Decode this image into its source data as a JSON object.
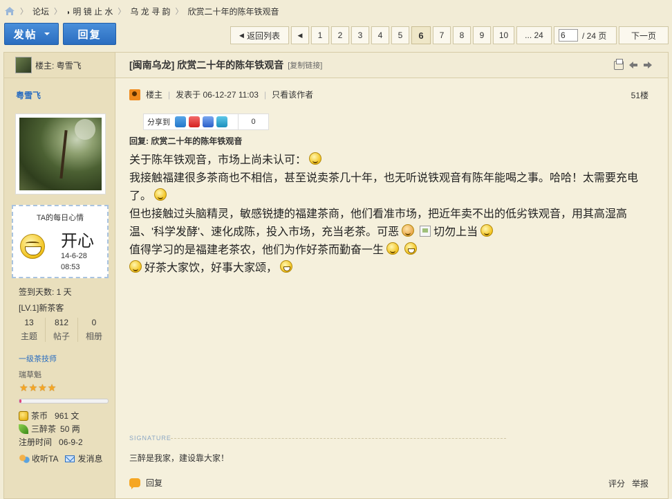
{
  "breadcrumb": {
    "items": [
      "论坛",
      "明 镜 止 水",
      "乌 龙 寻 韵",
      "欣赏二十年的陈年铁观音"
    ]
  },
  "toolbar": {
    "post_label": "发帖",
    "reply_label": "回复",
    "back_label": "返回列表",
    "pages": [
      "1",
      "2",
      "3",
      "4",
      "5",
      "6",
      "7",
      "8",
      "9",
      "10",
      "... 24"
    ],
    "current_page": "6",
    "page_input": "6",
    "total_pages": "/ 24 页",
    "next_label": "下一页"
  },
  "sidebar": {
    "header_label": "楼主: 粤雪飞",
    "username": "粤雪飞",
    "mood_title": "TA的每日心情",
    "mood_text": "开心",
    "mood_date": "14-6-28",
    "mood_time": "08:53",
    "signin": "签到天数: 1 天",
    "level": "[LV.1]新茶客",
    "stats": [
      {
        "num": "13",
        "label": "主题"
      },
      {
        "num": "812",
        "label": "帖子"
      },
      {
        "num": "0",
        "label": "相册"
      }
    ],
    "rank": "一级茶技师",
    "rank_sub": "瑞草魁",
    "star_count": 4,
    "level_progress": 0.02,
    "coin_label": "茶币",
    "coin_value": "961 文",
    "tea_label": "三醉茶",
    "tea_value": "50 两",
    "reg_label": "注册时间",
    "reg_value": "06-9-2",
    "follow_label": "收听TA",
    "message_label": "发消息"
  },
  "post": {
    "title": "[闽南乌龙] 欣赏二十年的陈年铁观音",
    "copy_link": "[复制链接]",
    "author_tag": "楼主",
    "posted_at": "发表于 06-12-27 11:03",
    "only_author": "只看该作者",
    "floor": "51楼",
    "share_label": "分享到",
    "share_count": "0",
    "reply_title": "回复: 欣赏二十年的陈年铁观音",
    "body": {
      "l1": "关于陈年铁观音，市场上尚未认可：",
      "l2": "我接触福建很多茶商也不相信，甚至说卖茶几十年，也无听说铁观音有陈年能喝之事。哈哈！太需要充电了。",
      "l3a": "但也接触过头脑精灵，敏感锐捷的福建茶商，他们看准市场，把近年卖不出的低劣铁观音，用其高湿高温、'科学发酵'、速化成陈，投入市场，充当老茶。可恶",
      "l3b": "切勿上当",
      "l4": "值得学习的是福建老茶农，他们为作好茶而勤奋一生",
      "l5": "好茶大家饮，好事大家颂，"
    },
    "signature_label": "SIGNATURE",
    "signature": "三醉是我家，建设靠大家！",
    "reply_label": "回复",
    "rate_label": "评分",
    "report_label": "举报"
  }
}
